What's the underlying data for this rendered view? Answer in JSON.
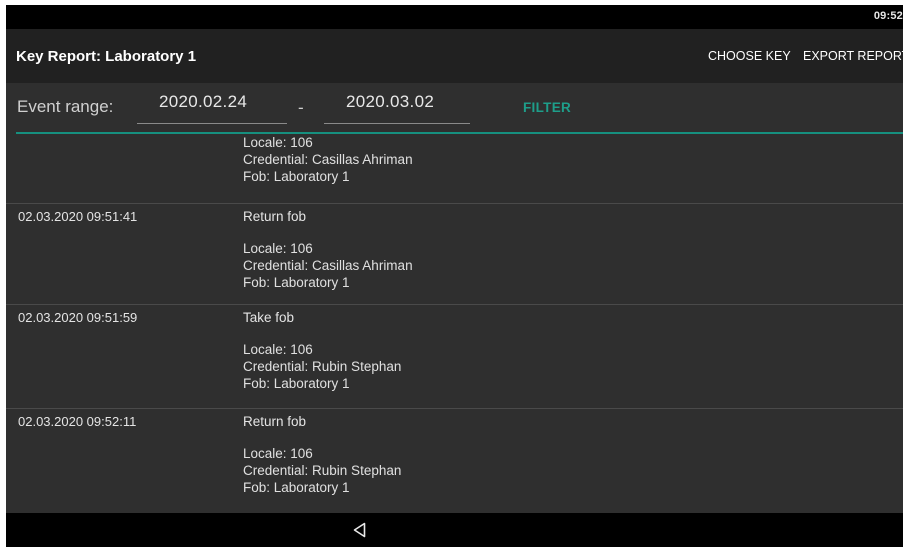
{
  "status_bar": {
    "time": "09:52"
  },
  "app_bar": {
    "title": "Key Report: Laboratory 1",
    "choose_key": "CHOOSE KEY",
    "export_report": "EXPORT REPORT"
  },
  "filter": {
    "label": "Event range:",
    "from": "2020.02.24",
    "separator": "-",
    "to": "2020.03.02",
    "button": "FILTER"
  },
  "events": [
    {
      "timestamp": "",
      "event": "",
      "locale": "Locale: 106",
      "credential": "Credential: Casillas Ahriman",
      "fob": "Fob: Laboratory 1"
    },
    {
      "timestamp": "02.03.2020 09:51:41",
      "event": "Return fob",
      "locale": "Locale: 106",
      "credential": "Credential: Casillas Ahriman",
      "fob": "Fob: Laboratory 1"
    },
    {
      "timestamp": "02.03.2020 09:51:59",
      "event": "Take fob",
      "locale": "Locale: 106",
      "credential": "Credential: Rubin Stephan",
      "fob": "Fob: Laboratory 1"
    },
    {
      "timestamp": "02.03.2020 09:52:11",
      "event": "Return fob",
      "locale": "Locale: 106",
      "credential": "Credential: Rubin Stephan",
      "fob": "Fob: Laboratory 1"
    }
  ],
  "nav_bar": {
    "back_icon": "back-triangle-icon"
  },
  "colors": {
    "accent": "#16907f",
    "filter_button": "#1e9e8a",
    "background": "#2f2f2f",
    "app_bar": "#212121"
  }
}
